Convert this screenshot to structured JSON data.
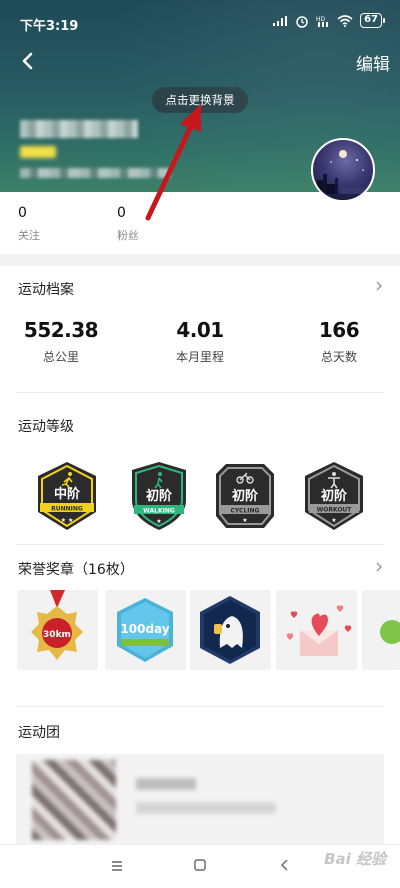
{
  "status_bar": {
    "time": "下午3:19",
    "battery": "67"
  },
  "header": {
    "edit_label": "编辑",
    "change_background_label": "点击更换背景"
  },
  "follow": {
    "following_count": "0",
    "following_label": "关注",
    "fans_count": "0",
    "fans_label": "粉丝"
  },
  "sports_profile": {
    "title": "运动档案",
    "stats": [
      {
        "value": "552.38",
        "label": "总公里"
      },
      {
        "value": "4.01",
        "label": "本月里程"
      },
      {
        "value": "166",
        "label": "总天数"
      }
    ]
  },
  "sports_level": {
    "title": "运动等级",
    "badges": [
      {
        "level": "中阶",
        "type": "RUNNING",
        "icon": "running-icon",
        "color": "#f2d21b"
      },
      {
        "level": "初阶",
        "type": "WALKING",
        "icon": "walking-icon",
        "color": "#2fb67f"
      },
      {
        "level": "初阶",
        "type": "CYCLING",
        "icon": "cycling-icon",
        "color": "#9a9a9a"
      },
      {
        "level": "初阶",
        "type": "WORKOUT",
        "icon": "workout-icon",
        "color": "#9a9a9a"
      }
    ]
  },
  "honor_medals": {
    "title": "荣誉奖章（16枚）",
    "medals": [
      {
        "name": "30km-medal-icon",
        "text": "30km"
      },
      {
        "name": "100day-medal-icon",
        "text": "100day"
      },
      {
        "name": "ghost-medal-icon",
        "text": ""
      },
      {
        "name": "love-letter-medal-icon",
        "text": ""
      },
      {
        "name": "partial-medal-icon",
        "text": ""
      }
    ]
  },
  "sports_team": {
    "title": "运动团"
  },
  "watermark": "Bai 经验"
}
